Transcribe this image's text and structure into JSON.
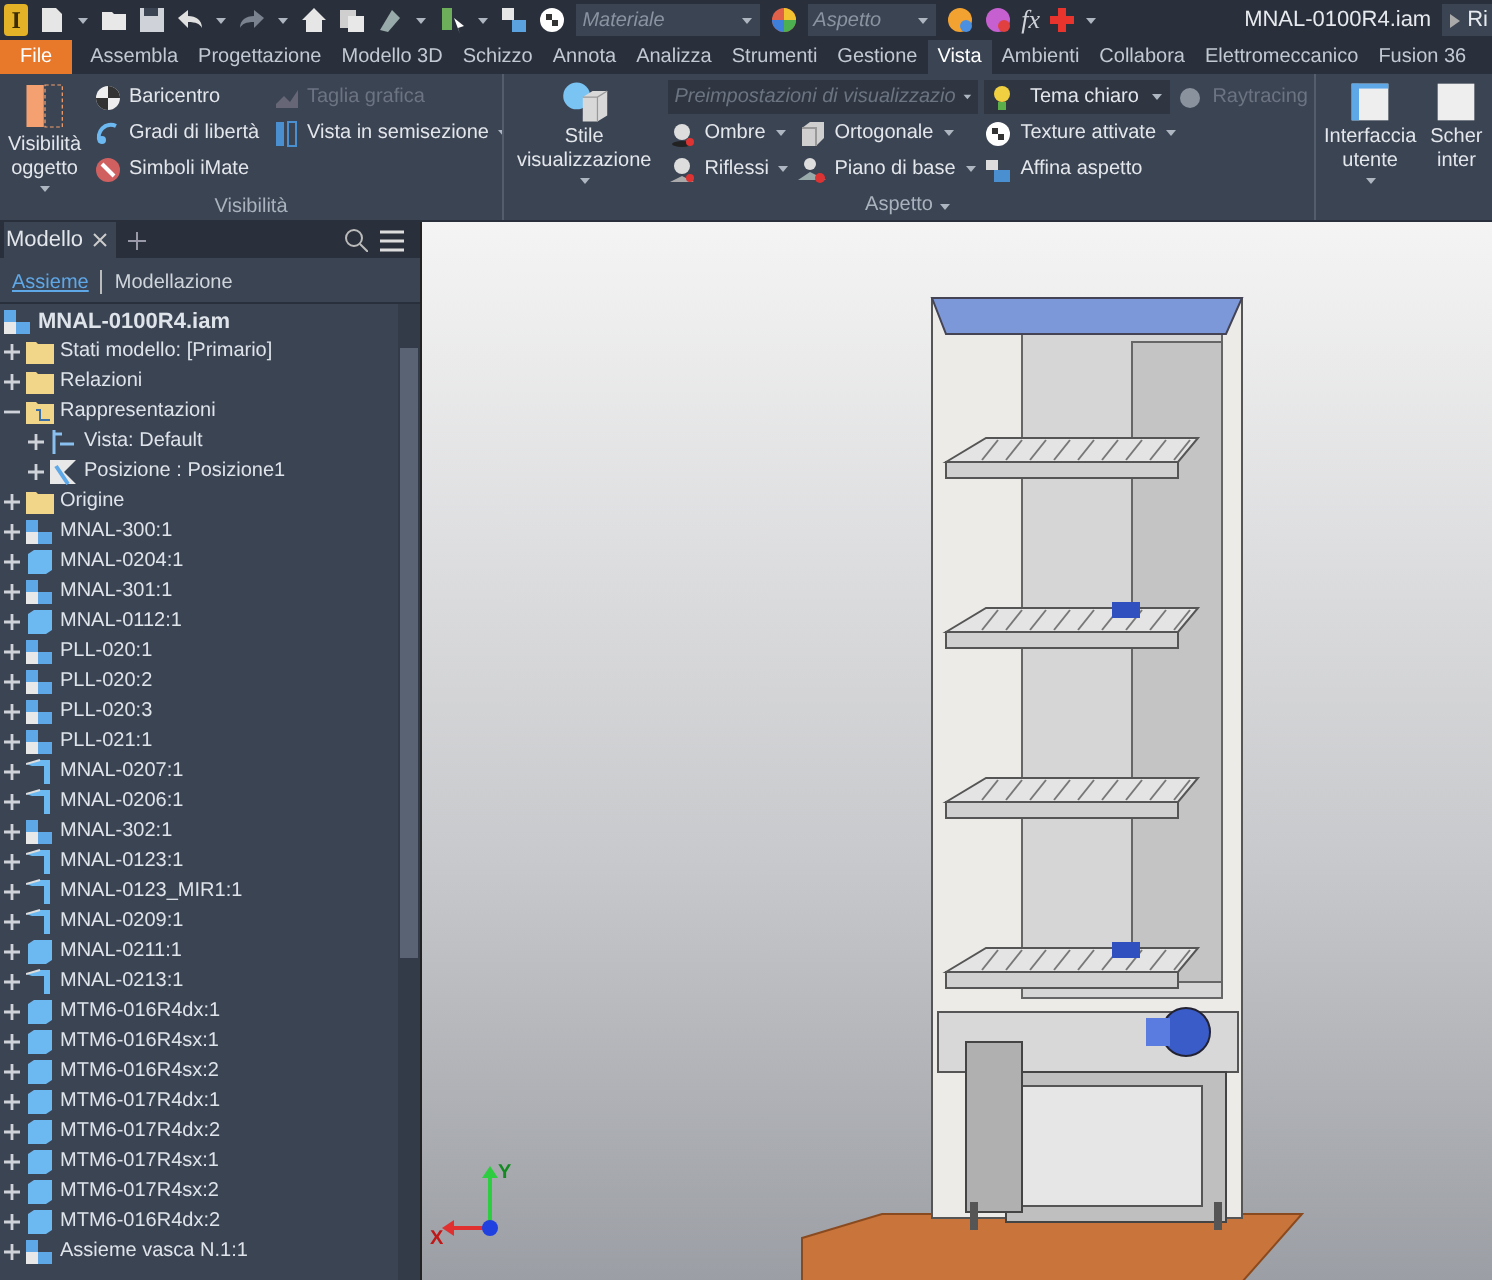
{
  "quick_access": {
    "app_logo": "I",
    "fields": [
      {
        "placeholder": "Materiale"
      },
      {
        "placeholder": "Aspetto"
      }
    ],
    "formula_button": "fx",
    "title": "MNAL-0100R4.iam",
    "search_text": "Ri"
  },
  "ribbon_tabs": [
    {
      "label": "File",
      "selected": false,
      "kind": "file"
    },
    {
      "label": "Assembla",
      "selected": false,
      "kind": "tab"
    },
    {
      "label": "Progettazione",
      "selected": false,
      "kind": "tab"
    },
    {
      "label": "Modello 3D",
      "selected": false,
      "kind": "tab"
    },
    {
      "label": "Schizzo",
      "selected": false,
      "kind": "tab"
    },
    {
      "label": "Annota",
      "selected": false,
      "kind": "tab"
    },
    {
      "label": "Analizza",
      "selected": false,
      "kind": "tab"
    },
    {
      "label": "Strumenti",
      "selected": false,
      "kind": "tab"
    },
    {
      "label": "Gestione",
      "selected": false,
      "kind": "tab"
    },
    {
      "label": "Vista",
      "selected": true,
      "kind": "tab"
    },
    {
      "label": "Ambienti",
      "selected": false,
      "kind": "tab"
    },
    {
      "label": "Collabora",
      "selected": false,
      "kind": "tab"
    },
    {
      "label": "Elettromeccanico",
      "selected": false,
      "kind": "tab"
    },
    {
      "label": "Fusion 36",
      "selected": false,
      "kind": "tab"
    }
  ],
  "ribbon_panels": [
    {
      "title": "Visibilità",
      "title_menu": false,
      "large": [
        {
          "label": "Visibilità\noggetto",
          "menu": true,
          "disabled": false
        }
      ],
      "rows": [
        [
          {
            "kind": "button",
            "label": "Baricentro",
            "menu": false,
            "disabled": false
          },
          {
            "kind": "button",
            "label": "Taglia grafica",
            "menu": false,
            "disabled": true
          }
        ],
        [
          {
            "kind": "button",
            "label": "Gradi di libertà",
            "menu": false,
            "disabled": false
          },
          {
            "kind": "button",
            "label": "Vista in semisezione",
            "menu": true,
            "disabled": false
          }
        ],
        [
          {
            "kind": "button",
            "label": "Simboli iMate",
            "menu": false,
            "disabled": false
          }
        ]
      ]
    },
    {
      "title": "Aspetto",
      "title_menu": true,
      "large": [
        {
          "label": "Stile visualizzazione",
          "menu": true,
          "disabled": false
        }
      ],
      "combo_row": [
        {
          "kind": "combo",
          "label": "Preimpostazioni di visualizzazio",
          "menu": true,
          "disabled": true
        },
        {
          "kind": "combo",
          "label": "Tema chiaro",
          "menu": true,
          "disabled": false
        },
        {
          "kind": "button",
          "label": "Raytracing",
          "menu": false,
          "disabled": true
        }
      ],
      "rows": [
        [
          {
            "kind": "button",
            "label": "Ombre",
            "menu": true,
            "disabled": false
          },
          {
            "kind": "button",
            "label": "Ortogonale",
            "menu": true,
            "disabled": false
          },
          {
            "kind": "button",
            "label": "Texture attivate",
            "menu": true,
            "disabled": false
          }
        ],
        [
          {
            "kind": "button",
            "label": "Riflessi",
            "menu": true,
            "disabled": false
          },
          {
            "kind": "button",
            "label": "Piano di base",
            "menu": true,
            "disabled": false
          },
          {
            "kind": "button",
            "label": "Affina aspetto",
            "menu": false,
            "disabled": false
          }
        ]
      ]
    },
    {
      "large": [
        {
          "label": "Interfaccia\nutente",
          "menu": true,
          "disabled": false
        },
        {
          "label": "Scher\ninter",
          "menu": false,
          "disabled": false
        }
      ]
    }
  ],
  "browser": {
    "tab": "Modello",
    "subtabs": [
      {
        "label": "Assieme",
        "selected": true
      },
      {
        "label": "Modellazione",
        "selected": false
      }
    ],
    "root": {
      "label": "MNAL-0100R4.iam",
      "kind": "assembly",
      "children": [
        {
          "label": "Stati modello: [Primario]",
          "kind": "folder",
          "expanded": false
        },
        {
          "label": "Relazioni",
          "kind": "folder",
          "expanded": false
        },
        {
          "label": "Rappresentazioni",
          "kind": "representations",
          "expanded": true,
          "children": [
            {
              "label": "Vista: Default",
              "kind": "view",
              "expanded": false
            },
            {
              "label": "Posizione : Posizione1",
              "kind": "position",
              "expanded": false
            }
          ]
        },
        {
          "label": "Origine",
          "kind": "folder",
          "expanded": false
        },
        {
          "label": "MNAL-300:1",
          "kind": "assembly",
          "expanded": false
        },
        {
          "label": "MNAL-0204:1",
          "kind": "part",
          "expanded": false
        },
        {
          "label": "MNAL-301:1",
          "kind": "assembly",
          "expanded": false
        },
        {
          "label": "MNAL-0112:1",
          "kind": "part",
          "expanded": false
        },
        {
          "label": "PLL-020:1",
          "kind": "assembly",
          "expanded": false
        },
        {
          "label": "PLL-020:2",
          "kind": "assembly",
          "expanded": false
        },
        {
          "label": "PLL-020:3",
          "kind": "assembly",
          "expanded": false
        },
        {
          "label": "PLL-021:1",
          "kind": "assembly",
          "expanded": false
        },
        {
          "label": "MNAL-0207:1",
          "kind": "sheetmetal",
          "expanded": false
        },
        {
          "label": "MNAL-0206:1",
          "kind": "sheetmetal",
          "expanded": false
        },
        {
          "label": "MNAL-302:1",
          "kind": "assembly",
          "expanded": false
        },
        {
          "label": "MNAL-0123:1",
          "kind": "sheetmetal",
          "expanded": false
        },
        {
          "label": "MNAL-0123_MIR1:1",
          "kind": "sheetmetal",
          "expanded": false
        },
        {
          "label": "MNAL-0209:1",
          "kind": "sheetmetal",
          "expanded": false
        },
        {
          "label": "MNAL-0211:1",
          "kind": "part",
          "expanded": false
        },
        {
          "label": "MNAL-0213:1",
          "kind": "sheetmetal",
          "expanded": false
        },
        {
          "label": "MTM6-016R4dx:1",
          "kind": "part",
          "expanded": false
        },
        {
          "label": "MTM6-016R4sx:1",
          "kind": "part",
          "expanded": false
        },
        {
          "label": "MTM6-016R4sx:2",
          "kind": "part",
          "expanded": false
        },
        {
          "label": "MTM6-017R4dx:1",
          "kind": "part",
          "expanded": false
        },
        {
          "label": "MTM6-017R4dx:2",
          "kind": "part",
          "expanded": false
        },
        {
          "label": "MTM6-017R4sx:1",
          "kind": "part",
          "expanded": false
        },
        {
          "label": "MTM6-017R4sx:2",
          "kind": "part",
          "expanded": false
        },
        {
          "label": "MTM6-016R4dx:2",
          "kind": "part",
          "expanded": false
        },
        {
          "label": "Assieme vasca N.1:1",
          "kind": "assembly",
          "expanded": false
        }
      ]
    }
  },
  "viewport": {
    "axis_labels": [
      "Y",
      "X"
    ]
  }
}
